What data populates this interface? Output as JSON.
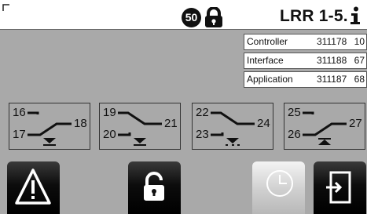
{
  "header": {
    "badge": "50",
    "device": "LRR 1-5."
  },
  "versions": [
    {
      "name": "Controller",
      "number": "311178",
      "rev": "10"
    },
    {
      "name": "Interface",
      "number": "311188",
      "rev": "67"
    },
    {
      "name": "Application",
      "number": "311187",
      "rev": "68"
    }
  ],
  "relays": [
    {
      "common": "16",
      "nc": "17",
      "no": "18"
    },
    {
      "common": "19",
      "nc": "20",
      "no": "21"
    },
    {
      "common": "22",
      "nc": "23",
      "no": "24"
    },
    {
      "common": "25",
      "nc": "26",
      "no": "27"
    }
  ],
  "toolbar": {
    "buttons": [
      "alarm-button",
      "unlock-button",
      "clock-button",
      "exit-button"
    ]
  }
}
